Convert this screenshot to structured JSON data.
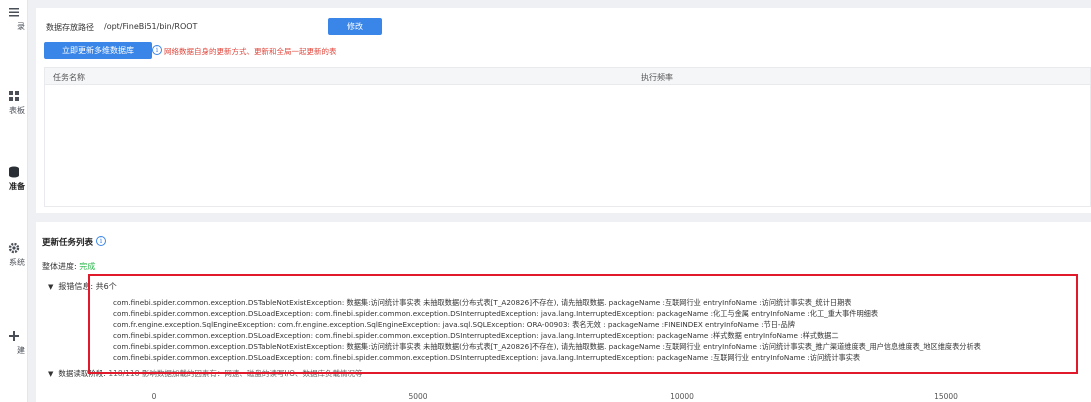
{
  "sidebar": {
    "items": [
      {
        "label": "录",
        "icon": "menu-icon"
      },
      {
        "label": "表板",
        "icon": "dashboard-icon"
      },
      {
        "label": "准备",
        "icon": "database-icon"
      },
      {
        "label": "系统",
        "icon": "gear-icon"
      },
      {
        "label": "建",
        "icon": "plus-icon"
      }
    ]
  },
  "storage": {
    "label": "数据存放路径",
    "path": "/opt/FineBi51/bin/ROOT",
    "modify_button": "修改"
  },
  "update": {
    "button": "立即更新多维数据库",
    "hint": "网络数据自身的更新方式、更新和全局一起更新的表"
  },
  "task_table": {
    "columns": [
      "任务名称",
      "执行频率"
    ],
    "rows": []
  },
  "update_list": {
    "title": "更新任务列表",
    "progress_label": "整体进度:",
    "progress_status": "完成",
    "error_header": "报错信息: 共6个",
    "errors": [
      "com.finebi.spider.common.exception.DSTableNotExistException: 数据集:访问统计事实表 未抽取数据(分布式表[T_A20826]不存在), 请先抽取数据. packageName :互联网行业 entryInfoName :访问统计事实表_统计日期表",
      "com.finebi.spider.common.exception.DSLoadException: com.finebi.spider.common.exception.DSInterruptedException: java.lang.InterruptedException: packageName :化工与金属 entryInfoName :化工_重大事件明细表",
      "com.fr.engine.exception.SqlEngineException: com.fr.engine.exception.SqlEngineException: java.sql.SQLException: ORA-00903: 表名无效 : packageName :FINEINDEX entryInfoName :节日-品牌",
      "com.finebi.spider.common.exception.DSLoadException: com.finebi.spider.common.exception.DSInterruptedException: java.lang.InterruptedException: packageName :样式数据 entryInfoName :样式数据二",
      "com.finebi.spider.common.exception.DSTableNotExistException: 数据集:访问统计事实表 未抽取数据(分布式表[T_A20826]不存在), 请先抽取数据. packageName :互联网行业 entryInfoName :访问统计事实表_推广渠道维度表_用户信息维度表_地区维度表分析表",
      "com.finebi.spider.common.exception.DSLoadException: com.finebi.spider.common.exception.DSInterruptedException: java.lang.InterruptedException: packageName :互联网行业 entryInfoName :访问统计事实表"
    ],
    "read_label": "数据读取阶段:",
    "read_detail": "118/118 影响数据加载的因素有：网速、磁盘的读写I/O、数据库负载情况等"
  },
  "axis_ticks": [
    "0",
    "5000",
    "10000",
    "15000"
  ],
  "colors": {
    "accent": "#3a86e8",
    "warning": "#e0453b",
    "success": "#2db84d",
    "highlight": "#e0192b"
  }
}
